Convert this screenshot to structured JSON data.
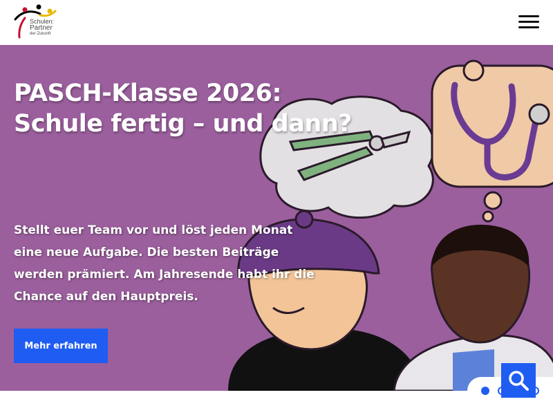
{
  "logo": {
    "line1": "Schulen:",
    "line2": "Partner",
    "line3": "der Zukunft"
  },
  "header": {
    "menu_icon": "hamburger-menu-icon"
  },
  "hero": {
    "headline_line1": "PASCH-Klasse 2026:",
    "headline_line2": "Schule fertig – und dann?",
    "intro": "Stellt euer Team vor und löst jeden Monat eine neue Aufgabe. Die besten Beiträge werden prämiert. Am Jahresende habt ihr die Chance auf den Hauptpreis.",
    "cta_label": "Mehr erfahren"
  },
  "carousel": {
    "active_slide": 1,
    "slide_count": 4
  },
  "search": {
    "icon": "search-icon"
  },
  "colors": {
    "accent": "#1f5cf2",
    "hero_bg": "#9b5f9d"
  }
}
